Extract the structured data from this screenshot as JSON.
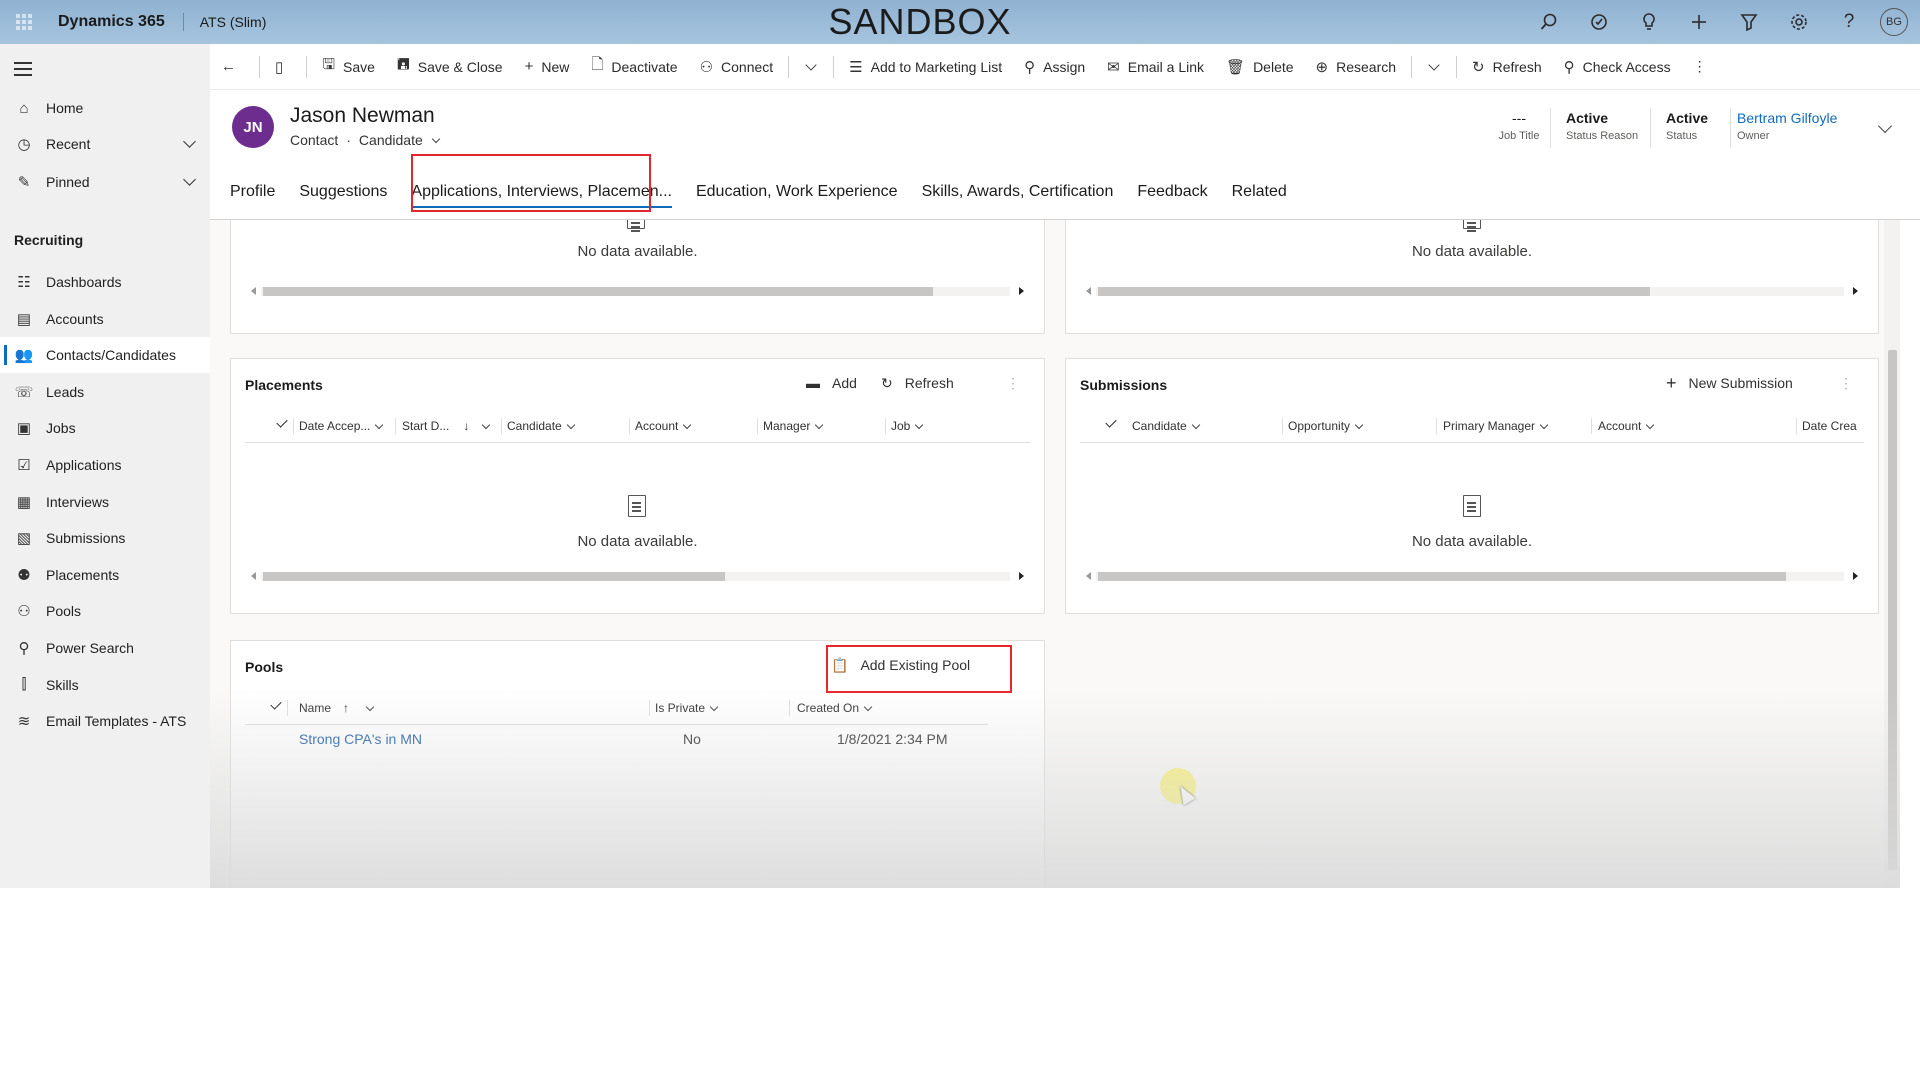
{
  "topbar": {
    "app_name": "Dynamics 365",
    "module": "ATS (Slim)",
    "banner": "SANDBOX",
    "user_initials": "BG"
  },
  "sidebar": {
    "home": "Home",
    "recent": "Recent",
    "pinned": "Pinned",
    "group_label": "Recruiting",
    "items": [
      {
        "label": "Dashboards",
        "icon": "dashboard-icon"
      },
      {
        "label": "Accounts",
        "icon": "accounts-icon"
      },
      {
        "label": "Contacts/Candidates",
        "icon": "contacts-icon"
      },
      {
        "label": "Leads",
        "icon": "leads-icon"
      },
      {
        "label": "Jobs",
        "icon": "jobs-icon"
      },
      {
        "label": "Applications",
        "icon": "applications-icon"
      },
      {
        "label": "Interviews",
        "icon": "interviews-icon"
      },
      {
        "label": "Submissions",
        "icon": "submissions-icon"
      },
      {
        "label": "Placements",
        "icon": "placements-icon"
      },
      {
        "label": "Pools",
        "icon": "pools-icon"
      },
      {
        "label": "Power Search",
        "icon": "power-search-icon"
      },
      {
        "label": "Skills",
        "icon": "skills-icon"
      },
      {
        "label": "Email Templates - ATS",
        "icon": "email-templates-icon"
      }
    ],
    "active": "Contacts/Candidates"
  },
  "commands": {
    "save": "Save",
    "save_close": "Save & Close",
    "new": "New",
    "deactivate": "Deactivate",
    "connect": "Connect",
    "add_marketing": "Add to Marketing List",
    "assign": "Assign",
    "email_link": "Email a Link",
    "delete": "Delete",
    "research": "Research",
    "refresh": "Refresh",
    "check_access": "Check Access"
  },
  "record": {
    "initials": "JN",
    "name": "Jason Newman",
    "entity": "Contact",
    "form": "Candidate",
    "job_title_value": "---",
    "job_title_label": "Job Title",
    "status_reason_value": "Active",
    "status_reason_label": "Status Reason",
    "status_value": "Active",
    "status_label": "Status",
    "owner_value": "Bertram Gilfoyle",
    "owner_label": "Owner"
  },
  "tabs": [
    "Profile",
    "Suggestions",
    "Applications, Interviews, Placemen...",
    "Education, Work Experience",
    "Skills, Awards, Certification",
    "Feedback",
    "Related"
  ],
  "selected_tab": "Applications, Interviews, Placemen...",
  "no_data": "No data available.",
  "placements": {
    "title": "Placements",
    "add": "Add",
    "refresh": "Refresh",
    "columns": [
      "Date Accep...",
      "Start D...",
      "Candidate",
      "Account",
      "Manager",
      "Job"
    ]
  },
  "submissions": {
    "title": "Submissions",
    "new": "New Submission",
    "columns": [
      "Candidate",
      "Opportunity",
      "Primary Manager",
      "Account",
      "Date Crea"
    ]
  },
  "pools": {
    "title": "Pools",
    "add_existing": "Add Existing Pool",
    "columns": [
      "Name",
      "Is Private",
      "Created On"
    ],
    "rows": [
      {
        "name": "Strong CPA's in MN",
        "is_private": "No",
        "created_on": "1/8/2021 2:34 PM"
      }
    ]
  },
  "colors": {
    "accent": "#0f6cbd",
    "highlight_box": "#e3282d",
    "avatar": "#6d2d8f"
  }
}
